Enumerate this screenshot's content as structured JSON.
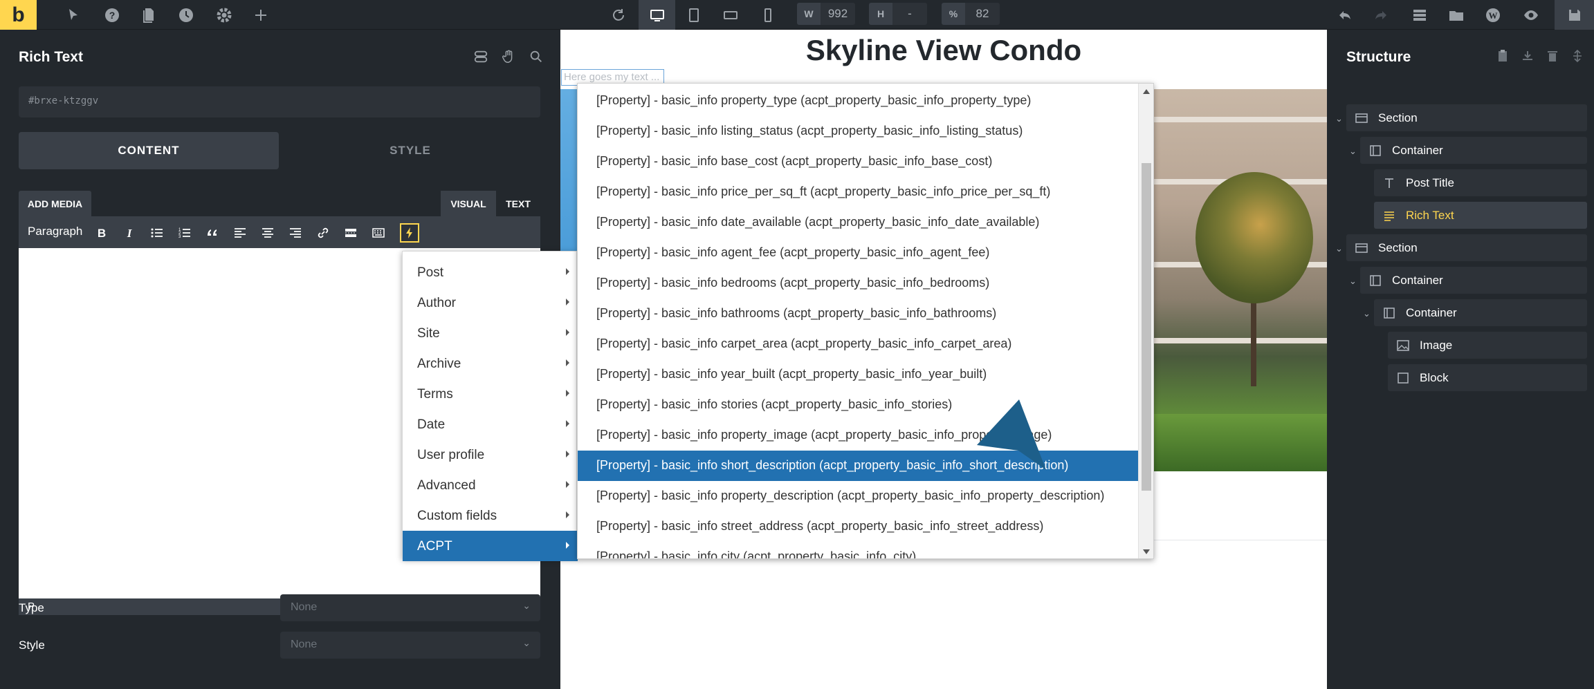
{
  "topbar": {
    "logo": "b",
    "width_label": "W",
    "width_value": "992",
    "height_label": "H",
    "height_value": "-",
    "zoom_label": "%",
    "zoom_value": "82"
  },
  "left_panel": {
    "title": "Rich Text",
    "css_id": "#brxe-ktzggv",
    "tabs": {
      "content": "CONTENT",
      "style": "STYLE"
    },
    "add_media": "ADD MEDIA",
    "editor_tabs": {
      "visual": "VISUAL",
      "text": "TEXT"
    },
    "format_select": "Paragraph",
    "status_path": "P",
    "type_label": "Type",
    "type_value": "None",
    "style_label": "Style",
    "style_value": "None"
  },
  "canvas": {
    "page_title": "Skyline View Condo",
    "placeholder": "Here goes my text ..."
  },
  "context_menu": {
    "items": [
      {
        "label": "Post"
      },
      {
        "label": "Author"
      },
      {
        "label": "Site"
      },
      {
        "label": "Archive"
      },
      {
        "label": "Terms"
      },
      {
        "label": "Date"
      },
      {
        "label": "User profile"
      },
      {
        "label": "Advanced"
      },
      {
        "label": "Custom fields"
      },
      {
        "label": "ACPT"
      }
    ],
    "selected": "ACPT"
  },
  "submenu": {
    "items": [
      "[Property] - basic_info property_type (acpt_property_basic_info_property_type)",
      "[Property] - basic_info listing_status (acpt_property_basic_info_listing_status)",
      "[Property] - basic_info base_cost (acpt_property_basic_info_base_cost)",
      "[Property] - basic_info price_per_sq_ft (acpt_property_basic_info_price_per_sq_ft)",
      "[Property] - basic_info date_available (acpt_property_basic_info_date_available)",
      "[Property] - basic_info agent_fee (acpt_property_basic_info_agent_fee)",
      "[Property] - basic_info bedrooms (acpt_property_basic_info_bedrooms)",
      "[Property] - basic_info bathrooms (acpt_property_basic_info_bathrooms)",
      "[Property] - basic_info carpet_area (acpt_property_basic_info_carpet_area)",
      "[Property] - basic_info year_built (acpt_property_basic_info_year_built)",
      "[Property] - basic_info stories (acpt_property_basic_info_stories)",
      "[Property] - basic_info property_image (acpt_property_basic_info_property_image)",
      "[Property] - basic_info short_description (acpt_property_basic_info_short_description)",
      "[Property] - basic_info property_description (acpt_property_basic_info_property_description)",
      "[Property] - basic_info street_address (acpt_property_basic_info_street_address)",
      "[Property] - basic_info city (acpt_property_basic_info_city)"
    ],
    "selected_index": 12
  },
  "structure": {
    "title": "Structure",
    "nodes": [
      {
        "label": "Section",
        "icon": "section-icon"
      },
      {
        "label": "Container",
        "icon": "container-icon"
      },
      {
        "label": "Post Title",
        "icon": "heading-icon"
      },
      {
        "label": "Rich Text",
        "icon": "text-icon"
      },
      {
        "label": "Section",
        "icon": "section-icon"
      },
      {
        "label": "Container",
        "icon": "container-icon"
      },
      {
        "label": "Container",
        "icon": "container-icon"
      },
      {
        "label": "Image",
        "icon": "image-icon"
      },
      {
        "label": "Block",
        "icon": "block-icon"
      }
    ],
    "selected": "Rich Text"
  },
  "colors": {
    "panel_bg": "#23282d",
    "accent_yellow": "#ffd64f",
    "selection_blue": "#2271b1"
  }
}
